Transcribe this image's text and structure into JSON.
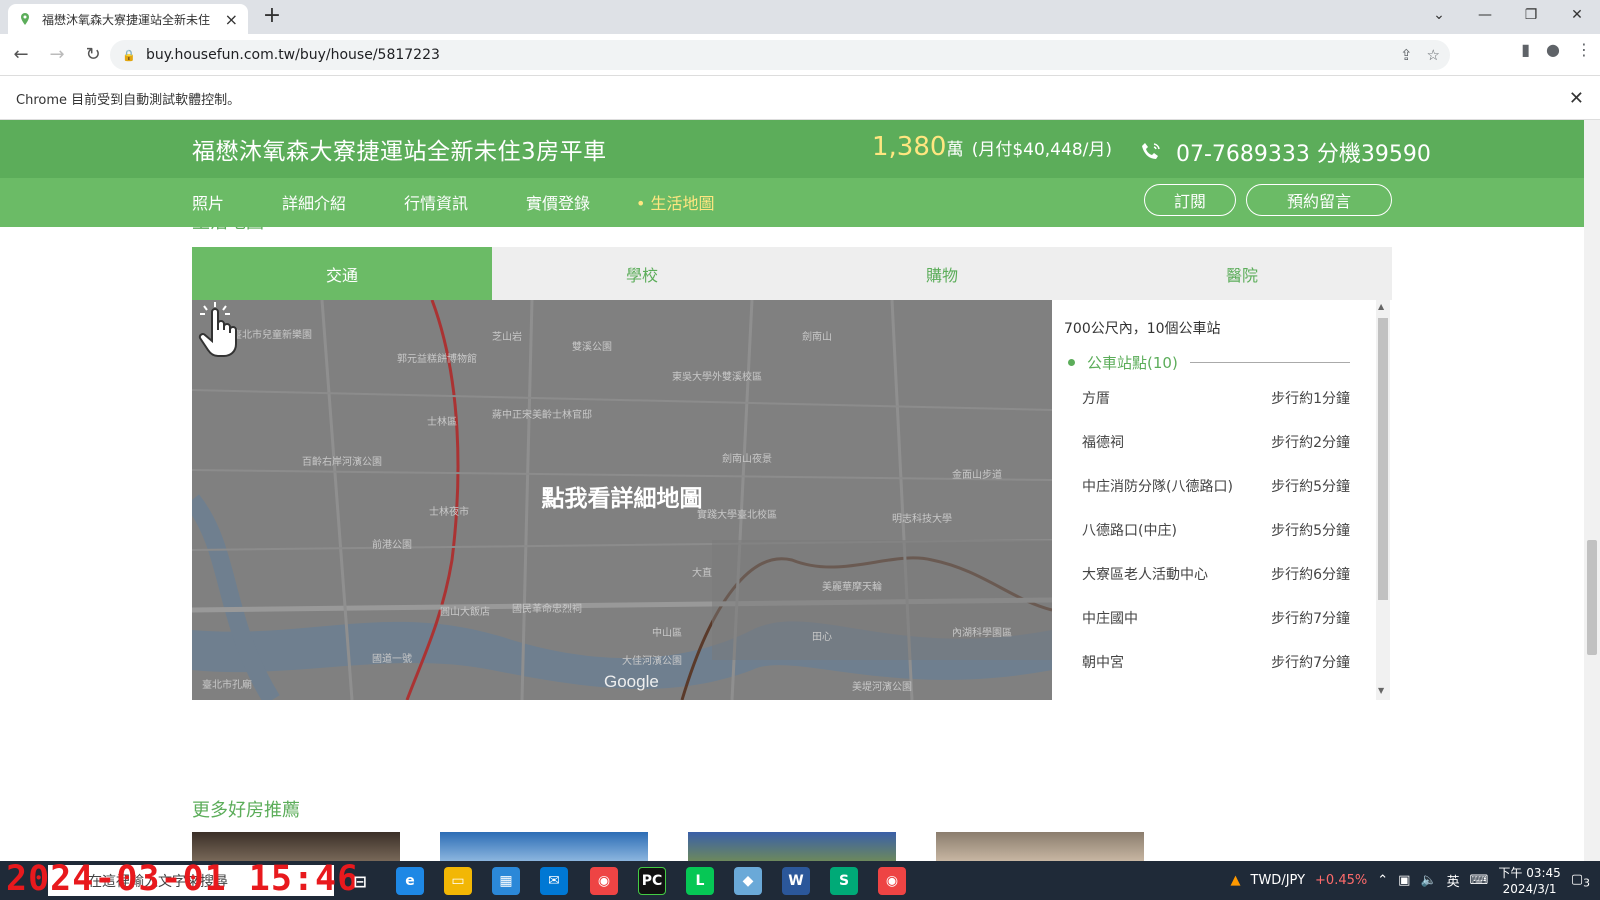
{
  "browser": {
    "tab_title": "福懋沐氧森大寮捷運站全新未住",
    "url": "buy.housefun.com.tw/buy/house/5817223",
    "infobar": "Chrome 目前受到自動測試軟體控制。"
  },
  "header": {
    "title": "福懋沐氧森大寮捷運站全新未住3房平車",
    "price": "1,380",
    "price_unit": "萬",
    "monthly": "(月付$40,448/月)",
    "phone": "07-7689333 分機39590",
    "nav": [
      "照片",
      "詳細介紹",
      "行情資訊",
      "實價登錄",
      "生活地圖"
    ],
    "subscribe": "訂閱",
    "appointment": "預約留言"
  },
  "section_title": "生活地圖",
  "categories": [
    "交通",
    "學校",
    "購物",
    "醫院"
  ],
  "map": {
    "cta": "點我看詳細地圖",
    "google": "Google",
    "labels": [
      "芝山岩",
      "臺北市兒童新樂園",
      "郭元益糕餅博物館",
      "雙溪公園",
      "東吳大學外雙溪校區",
      "劍南山",
      "士林區",
      "蔣中正宋美齡士林官邸",
      "百齡右岸河濱公園",
      "劍南山夜景",
      "金面山步道",
      "士林夜市",
      "實踐大學臺北校區",
      "明志科技大學",
      "前港公園",
      "大直",
      "美麗華摩天輪",
      "圓山大飯店",
      "國民革命忠烈祠",
      "中山區",
      "田心",
      "內湖科學園區",
      "臺北市孔廟",
      "大佳河濱公園",
      "美堤河濱公園",
      "國道一號"
    ]
  },
  "transit": {
    "summary": "700公尺內，10個公車站",
    "header": "公車站點(10)",
    "stops": [
      {
        "name": "方厝",
        "time": "步行約1分鐘"
      },
      {
        "name": "福德祠",
        "time": "步行約2分鐘"
      },
      {
        "name": "中庄消防分隊(八德路口)",
        "time": "步行約5分鐘"
      },
      {
        "name": "八德路口(中庄)",
        "time": "步行約5分鐘"
      },
      {
        "name": "大寮區老人活動中心",
        "time": "步行約6分鐘"
      },
      {
        "name": "中庄國中",
        "time": "步行約7分鐘"
      },
      {
        "name": "朝中宮",
        "time": "步行約7分鐘"
      }
    ]
  },
  "more_title": "更多好房推薦",
  "taskbar": {
    "search_placeholder": "在這裡輸入文字來搜尋",
    "stamp": "2024-03-01 15:46",
    "currency": "TWD/JPY",
    "currency_change": "+0.45%",
    "ime": "英",
    "time": "下午 03:45",
    "date": "2024/3/1",
    "notif_count": "3"
  },
  "colors": {
    "brand_green": "#5cad5a",
    "active_tab": "#6bbb66",
    "price": "#ffe680"
  }
}
